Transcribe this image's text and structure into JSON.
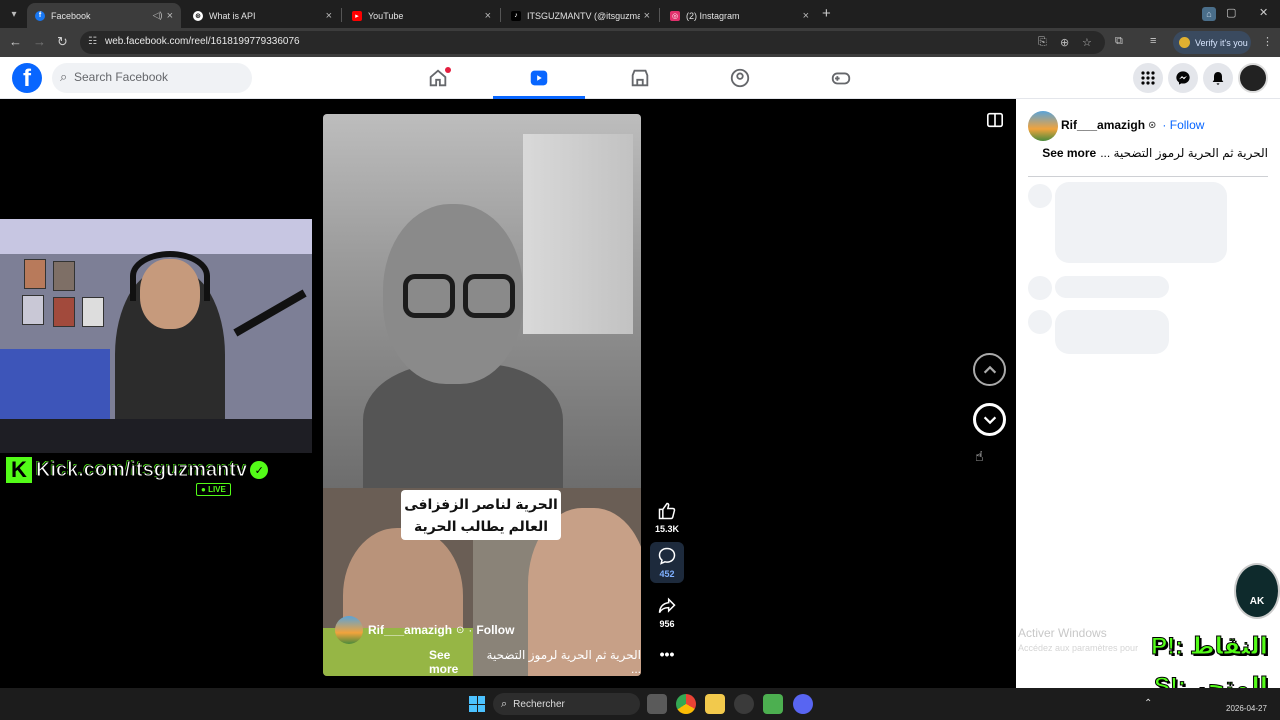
{
  "browser": {
    "tabs": [
      {
        "title": "Facebook",
        "active": true,
        "favicon": "facebook-icon",
        "color": "#1877f2"
      },
      {
        "title": "What is API",
        "active": false,
        "favicon": "openai-icon",
        "color": "#ffffff"
      },
      {
        "title": "YouTube",
        "active": false,
        "favicon": "youtube-icon",
        "color": "#ff0000"
      },
      {
        "title": "ITSGUZMANTV (@itsguzmantv",
        "active": false,
        "favicon": "tiktok-icon",
        "color": "#000000"
      },
      {
        "title": "(2) Instagram",
        "active": false,
        "favicon": "instagram-icon",
        "color": "#e1306c"
      }
    ],
    "url": "web.facebook.com/reel/1618199779336076",
    "verify_label": "Verify it's you"
  },
  "fb": {
    "search_placeholder": "Search Facebook",
    "nav": [
      "home-icon",
      "reels-icon",
      "marketplace-icon",
      "groups-icon",
      "gaming-icon"
    ],
    "active_nav": "reels-icon",
    "brand_color": "#0866ff"
  },
  "reel": {
    "video_caption_line1": "الحرية لناصر الزفزافى",
    "video_caption_line2": "العالم يطالب الحرية",
    "username": "Rif___amazigh",
    "follow": "Follow",
    "caption": "الحرية ثم الحرية لرموز التضحية ...",
    "see_more": "See more",
    "likes": "15.3K",
    "comments": "452",
    "shares": "956"
  },
  "stream": {
    "kick_url": "Kick.com/itsguzmantv",
    "live": "LIVE",
    "store_line1": "النقاط :!P",
    "store_line2": "المتجر :!S",
    "badge": "AK"
  },
  "side": {
    "username": "Rif___amazigh",
    "follow": "Follow",
    "caption": "الحرية ثم الحرية لرموز التضحية ...",
    "see_more": "See more"
  },
  "system": {
    "activate_title": "Activer Windows",
    "activate_sub": "Accédez aux paramètres pour",
    "search": "Rechercher",
    "date": "2026-04-27"
  }
}
